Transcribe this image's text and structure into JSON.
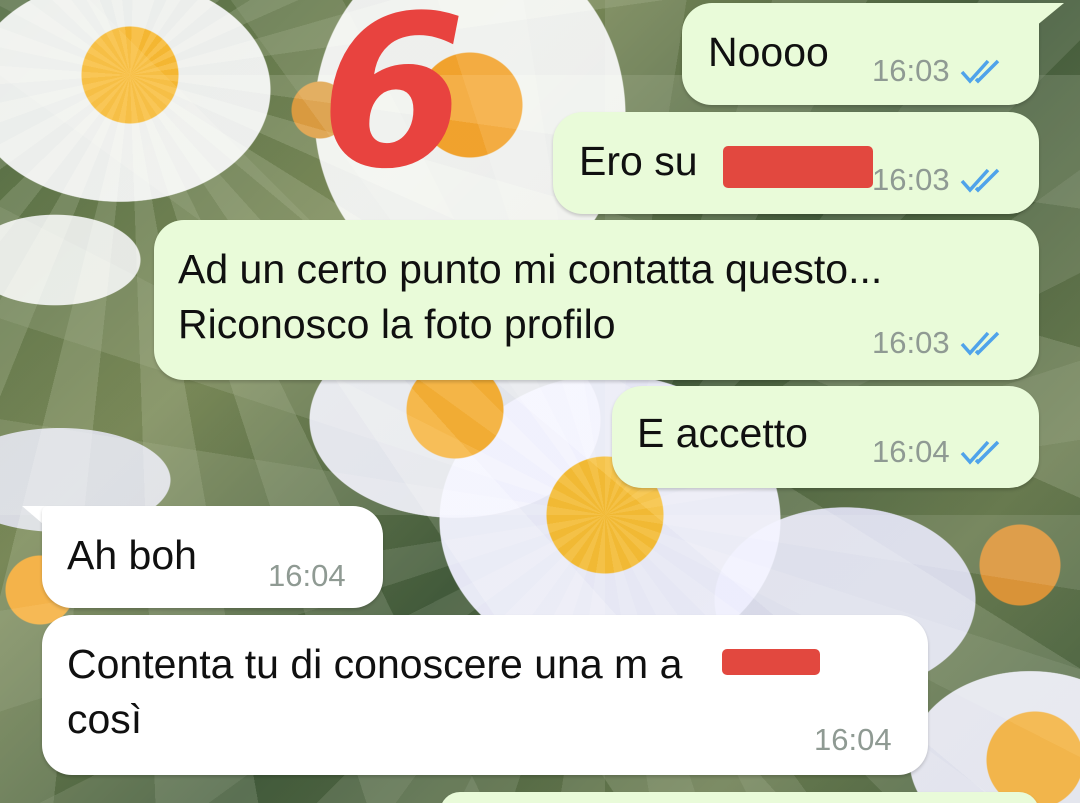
{
  "theme": {
    "outgoing_bubble": "#e9fbd9",
    "incoming_bubble": "#ffffff",
    "tick_color": "#4fa3ea",
    "annotation_color": "#e8433f"
  },
  "annotation": {
    "label": "6"
  },
  "messages": [
    {
      "direction": "outgoing",
      "text": "Noooo",
      "time": "16:03",
      "status": "read"
    },
    {
      "direction": "outgoing",
      "text": "Ero su",
      "time": "16:03",
      "status": "read",
      "redacted": true
    },
    {
      "direction": "outgoing",
      "text": "Ad un certo punto mi contatta questo...\nRiconosco la foto profilo",
      "time": "16:03",
      "status": "read"
    },
    {
      "direction": "outgoing",
      "text": "E accetto",
      "time": "16:04",
      "status": "read"
    },
    {
      "direction": "incoming",
      "text": "Ah boh",
      "time": "16:04"
    },
    {
      "direction": "incoming",
      "text": "Contenta tu di conoscere una m    a\ncosì",
      "time": "16:04",
      "redacted": true
    }
  ]
}
